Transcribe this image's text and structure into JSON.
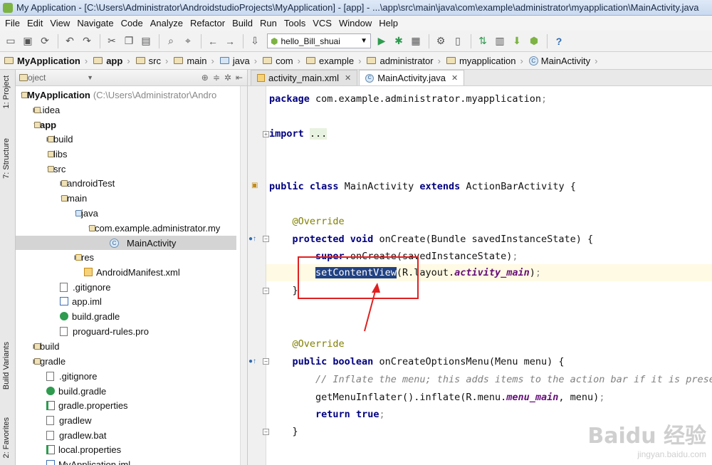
{
  "window": {
    "title": "My Application - [C:\\Users\\Administrator\\AndroidstudioProjects\\MyApplication] - [app] - ...\\app\\src\\main\\java\\com\\example\\administrator\\myapplication\\MainActivity.java"
  },
  "menu": [
    "File",
    "Edit",
    "View",
    "Navigate",
    "Code",
    "Analyze",
    "Refactor",
    "Build",
    "Run",
    "Tools",
    "VCS",
    "Window",
    "Help"
  ],
  "toolbar": {
    "run_config": "hello_Bill_shuai"
  },
  "breadcrumbs": [
    "MyApplication",
    "app",
    "src",
    "main",
    "java",
    "com",
    "example",
    "administrator",
    "myapplication",
    "MainActivity"
  ],
  "side_tabs": {
    "project": "1: Project",
    "structure": "7: Structure",
    "build_variants": "Build Variants",
    "favorites": "2: Favorites"
  },
  "project_panel": {
    "view_selector": "Project",
    "tree": [
      {
        "label": "MyApplication",
        "path": "(C:\\Users\\Administrator\\Andro",
        "bold": true
      },
      {
        "label": ".idea"
      },
      {
        "label": "app",
        "bold": true
      },
      {
        "label": "build"
      },
      {
        "label": "libs"
      },
      {
        "label": "src"
      },
      {
        "label": "androidTest"
      },
      {
        "label": "main"
      },
      {
        "label": "java"
      },
      {
        "label": "com.example.administrator.my"
      },
      {
        "label": "MainActivity"
      },
      {
        "label": "res"
      },
      {
        "label": "AndroidManifest.xml"
      },
      {
        "label": ".gitignore"
      },
      {
        "label": "app.iml"
      },
      {
        "label": "build.gradle"
      },
      {
        "label": "proguard-rules.pro"
      },
      {
        "label": "build"
      },
      {
        "label": "gradle"
      },
      {
        "label": ".gitignore"
      },
      {
        "label": "build.gradle"
      },
      {
        "label": "gradle.properties"
      },
      {
        "label": "gradlew"
      },
      {
        "label": "gradlew.bat"
      },
      {
        "label": "local.properties"
      },
      {
        "label": "MyApplication.iml"
      }
    ]
  },
  "editor": {
    "tabs": [
      "activity_main.xml",
      "MainActivity.java"
    ],
    "code": {
      "package": "com.example.administrator.myapplication",
      "import": "import",
      "import_fold": "...",
      "class_decl": "MainActivity",
      "class_parent": "ActionBarActivity",
      "override": "@Override",
      "oncreate_sig": "onCreate(Bundle savedInstanceState) {",
      "super_call": "onCreate(savedInstanceState)",
      "set_content": "setContentView",
      "layout_ref": "(R.layout.",
      "layout_name": "activity_main",
      "menu_sig": "onCreateOptionsMenu(Menu menu) {",
      "comment": "// Inflate the menu; this adds items to the action bar if it is present",
      "inflate": "getMenuInflater().inflate(R.menu.",
      "menu_name": "menu_main",
      "inflate_tail": ", menu)",
      "ret": "return",
      "ret_val": "true"
    }
  },
  "watermark": {
    "line1": "Baidu 经验",
    "line2": "jingyan.baidu.com"
  }
}
